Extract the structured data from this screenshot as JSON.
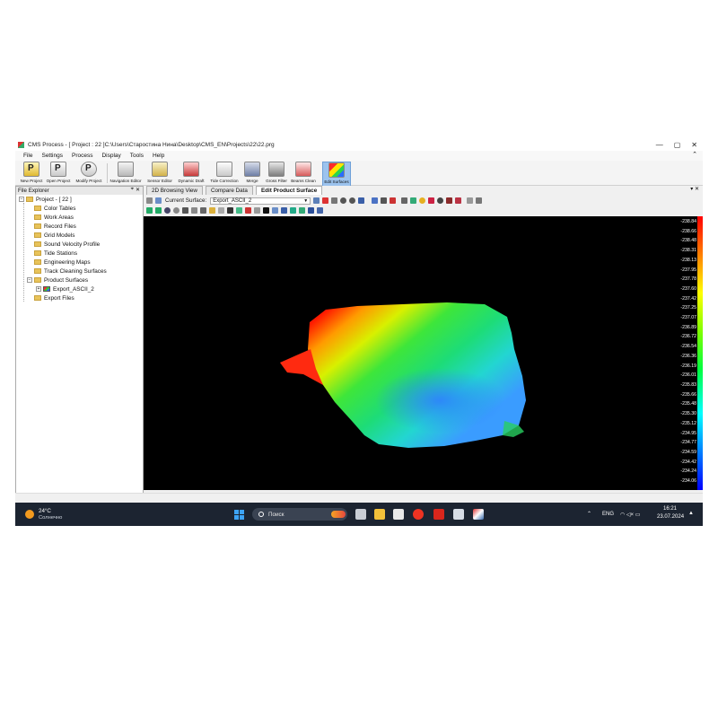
{
  "window": {
    "title": "CMS Process - [ Project : 22 ]C:\\Users\\Старостина Нина\\Desktop\\CMS_EN\\Projects\\22\\22.prg",
    "minimize": "—",
    "maximize": "▢",
    "close": "✕",
    "collapse_ribbon": "⌃"
  },
  "menu": [
    "File",
    "Settings",
    "Process",
    "Display",
    "Tools",
    "Help"
  ],
  "ribbon": {
    "groups": [
      {
        "label": "New Project",
        "icon": "new-project-icon"
      },
      {
        "label": "Open Project",
        "icon": "open-project-icon"
      },
      {
        "label": "Modify Project",
        "icon": "modify-project-icon"
      },
      {
        "label": "Navigation Editor",
        "icon": "navigation-editor-icon"
      },
      {
        "label": "Sensor Editor",
        "icon": "sensor-editor-icon"
      },
      {
        "label": "Dynamic Draft",
        "icon": "dynamic-draft-icon"
      },
      {
        "label": "Tide Correction",
        "icon": "tide-correction-icon"
      },
      {
        "label": "Merge",
        "icon": "merge-icon"
      },
      {
        "label": "Gross Filter",
        "icon": "gross-filter-icon"
      },
      {
        "label": "Beams Clean",
        "icon": "beams-clean-icon"
      },
      {
        "label": "Edit Surfaces",
        "icon": "edit-surfaces-icon"
      }
    ]
  },
  "explorer": {
    "title": "File Explorer",
    "pin": "⌖",
    "close": "✕",
    "root": "Project - [ 22 ]",
    "items": [
      "Color Tables",
      "Work Areas",
      "Record Files",
      "Grid Models",
      "Sound Velocity Profile",
      "Tide Stations",
      "Engineering Maps",
      "Track Cleaning Surfaces",
      "Product Surfaces"
    ],
    "product_child": "Export_ASCII_2",
    "export_files": "Export Files"
  },
  "tabs": [
    "2D Browsing View",
    "Compare Data",
    "Edit Product Surface"
  ],
  "tabs_controls": "▾ ✕",
  "surface": {
    "label": "Current Surface:",
    "value": "Export_ASCII_2"
  },
  "colorbar": {
    "labels": [
      "-238.84",
      "-238.66",
      "-238.48",
      "-238.31",
      "-238.13",
      "-237.95",
      "-237.78",
      "-237.60",
      "-237.42",
      "-237.25",
      "-237.07",
      "-236.89",
      "-236.72",
      "-236.54",
      "-236.36",
      "-236.19",
      "-236.01",
      "-235.83",
      "-235.66",
      "-235.48",
      "-235.30",
      "-235.12",
      "-234.95",
      "-234.77",
      "-234.59",
      "-234.42",
      "-234.24",
      "-234.06"
    ],
    "colors": [
      "#ff0000",
      "#ff8000",
      "#ffff00",
      "#80ff00",
      "#00ff40",
      "#00ffff",
      "#0080ff",
      "#0000ff"
    ]
  },
  "taskbar": {
    "temperature": "24°C",
    "weather": "Солнечно",
    "search_placeholder": "Поиск",
    "language": "ENG",
    "time": "16:21",
    "date": "23.07.2024",
    "tray_up": "⌃",
    "tray_icons": "◠ ◁× ▭"
  }
}
